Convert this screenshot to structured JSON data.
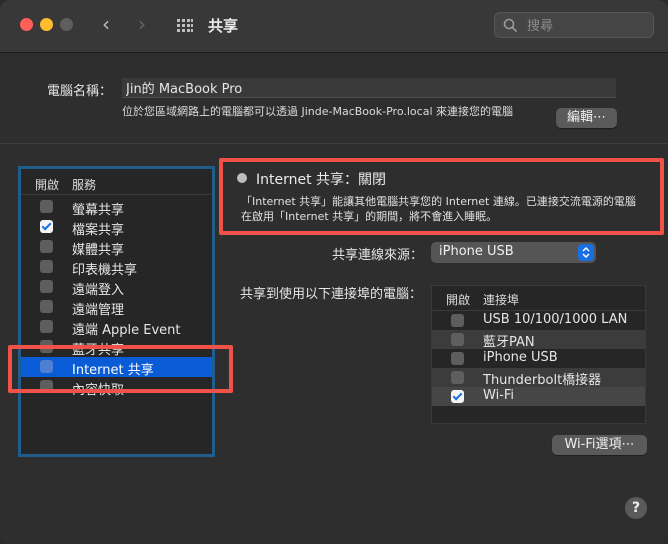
{
  "window": {
    "title": "共享",
    "search_placeholder": "搜尋"
  },
  "computer": {
    "name_label": "電腦名稱：",
    "name_value": "Jin的 MacBook Pro",
    "address_note": "位於您區域網路上的電腦都可以透過 Jinde-MacBook-Pro.local 來連接您的電腦",
    "edit_button": "編輯⋯"
  },
  "services": {
    "col_on": "開啟",
    "col_service": "服務",
    "items": [
      {
        "label": "螢幕共享",
        "checked": false
      },
      {
        "label": "檔案共享",
        "checked": true
      },
      {
        "label": "媒體共享",
        "checked": false
      },
      {
        "label": "印表機共享",
        "checked": false
      },
      {
        "label": "遠端登入",
        "checked": false
      },
      {
        "label": "遠端管理",
        "checked": false
      },
      {
        "label": "遠端 Apple Event",
        "checked": false
      },
      {
        "label": "藍牙共享",
        "checked": false
      },
      {
        "label": "Internet 共享",
        "checked": false,
        "selected": true
      },
      {
        "label": "內容快取",
        "checked": false
      }
    ]
  },
  "detail": {
    "status_title": "Internet 共享：關閉",
    "status_color": "#bdbdbd",
    "description": "「Internet 共享」能讓其他電腦共享您的 Internet 連線。已連接交流電源的電腦在啟用「Internet 共享」的期間，將不會進入睡眠。",
    "source_label": "共享連線來源：",
    "source_value": "iPhone USB",
    "ports_label": "共享到使用以下連接埠的電腦：",
    "ports_col_on": "開啟",
    "ports_col_port": "連接埠",
    "ports": [
      {
        "label": "USB 10/100/1000 LAN",
        "checked": false
      },
      {
        "label": "藍牙PAN",
        "checked": false
      },
      {
        "label": "iPhone USB",
        "checked": false
      },
      {
        "label": "Thunderbolt橋接器",
        "checked": false
      },
      {
        "label": "Wi-Fi",
        "checked": true
      }
    ],
    "wifi_options_button": "Wi-Fi選項⋯"
  },
  "help_button": "?",
  "colors": {
    "accent": "#0a5bd6",
    "annotation_red": "#f0524a",
    "annotation_blue": "#1f5d8c"
  }
}
